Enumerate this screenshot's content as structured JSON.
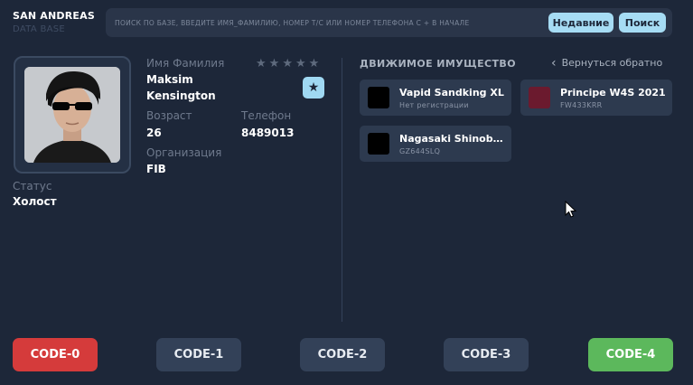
{
  "brand": {
    "title": "SAN ANDREAS",
    "subtitle": "DATA BASE"
  },
  "search": {
    "placeholder": "ПОИСК ПО БАЗЕ, ВВЕДИТЕ ИМЯ_ФАМИЛИЮ, НОМЕР Т/С ИЛИ НОМЕР ТЕЛЕФОНА С + В НАЧАЛЕ",
    "value": "",
    "recent_label": "Недавние",
    "search_label": "Поиск"
  },
  "profile": {
    "name_label": "Имя Фамилия",
    "first_name": "Maksim",
    "last_name": "Kensington",
    "age_label": "Возраст",
    "age": "26",
    "phone_label": "Телефон",
    "phone": "8489013",
    "org_label": "Организация",
    "org": "FIB",
    "status_label": "Статус",
    "status": "Холост",
    "rating": 0,
    "rating_max": 5
  },
  "vehicles": {
    "title": "ДВИЖИМОЕ ИМУЩЕСТВО",
    "back_label": "Вернуться обратно",
    "items": [
      {
        "name": "Vapid Sandking XL",
        "plate": "Нет регистрации",
        "color": "#000000"
      },
      {
        "name": "Principe W4S 2021",
        "plate": "FW433KRR",
        "color": "#6b1a2e"
      },
      {
        "name": "Nagasaki Shinobi ...",
        "plate": "GZ644SLQ",
        "color": "#000000"
      }
    ]
  },
  "codes": [
    "CODE-0",
    "CODE-1",
    "CODE-2",
    "CODE-3",
    "CODE-4"
  ],
  "colors": {
    "background": "#1d2739",
    "accent": "#a6dcf4",
    "code_red": "#d53b3b",
    "code_green": "#5cb85c",
    "code_neutral": "#334158"
  }
}
